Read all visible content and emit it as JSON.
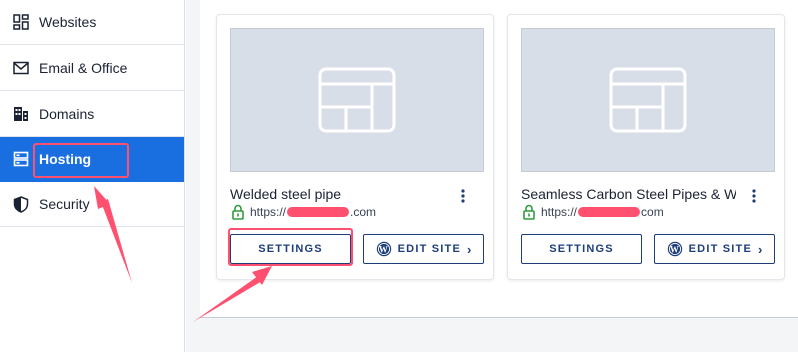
{
  "sidebar": {
    "items": [
      {
        "label": "Websites",
        "icon": "dashboard-grid-icon"
      },
      {
        "label": "Email & Office",
        "icon": "envelope-icon"
      },
      {
        "label": "Domains",
        "icon": "building-icon"
      },
      {
        "label": "Hosting",
        "icon": "server-icon",
        "active": true
      },
      {
        "label": "Security",
        "icon": "shield-icon"
      }
    ]
  },
  "sites": [
    {
      "name": "Welded steel pipe",
      "url_prefix": "https://",
      "url_suffix": ".com",
      "settings_label": "SETTINGS",
      "edit_label": "EDIT SITE"
    },
    {
      "name": "Seamless Carbon Steel Pipes & Wel...",
      "url_prefix": "https://",
      "url_suffix": "com",
      "settings_label": "SETTINGS",
      "edit_label": "EDIT SITE"
    }
  ],
  "colors": {
    "active": "#1a6fe0",
    "annotation": "#ff5070",
    "button": "#1e3e7a",
    "lock": "#2e9b3f"
  }
}
